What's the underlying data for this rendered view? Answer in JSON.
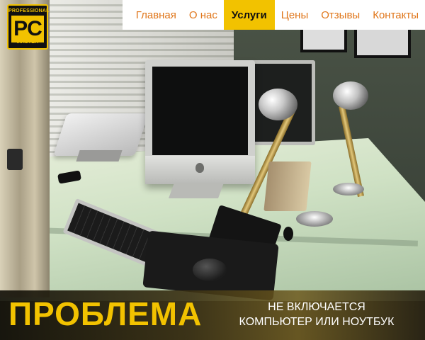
{
  "logo": {
    "top_text": "PROFESSIONAL",
    "main_text": "PC",
    "bottom_text": "MASTER"
  },
  "nav": {
    "items": [
      {
        "label": "Главная"
      },
      {
        "label": "О нас"
      },
      {
        "label": "Услуги"
      },
      {
        "label": "Цены"
      },
      {
        "label": "Отзывы"
      },
      {
        "label": "Контакты"
      }
    ],
    "active_label": "Услуги"
  },
  "banner": {
    "title": "ПРОБЛЕМА",
    "line1": "НЕ ВКЛЮЧАЕТСЯ",
    "line2": "КОМПЬЮТЕР ИЛИ НОУТБУК"
  },
  "colors": {
    "accent": "#f2c200",
    "nav_text": "#e0761a",
    "nav_bg": "#ffffff"
  }
}
